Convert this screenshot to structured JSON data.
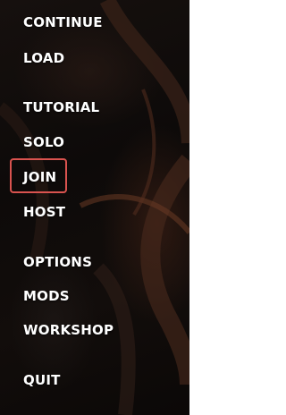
{
  "menu": {
    "items": [
      {
        "id": "continue",
        "label": "CONTINUE"
      },
      {
        "id": "load",
        "label": "LOAD"
      },
      {
        "id": "tutorial",
        "label": "TUTORIAL"
      },
      {
        "id": "solo",
        "label": "SOLO"
      },
      {
        "id": "join",
        "label": "JOIN"
      },
      {
        "id": "host",
        "label": "HOST"
      },
      {
        "id": "options",
        "label": "OPTIONS"
      },
      {
        "id": "mods",
        "label": "MODS"
      },
      {
        "id": "workshop",
        "label": "WORKSHOP"
      },
      {
        "id": "quit",
        "label": "QUIT"
      }
    ],
    "selected": "JOIN",
    "highlight_color": "#d9534f"
  }
}
